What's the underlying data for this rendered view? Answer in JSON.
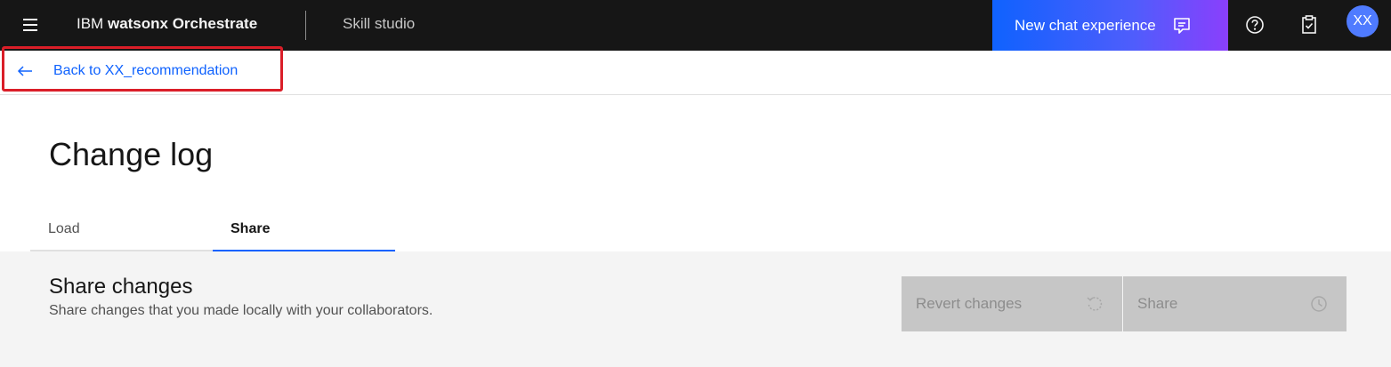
{
  "header": {
    "brand_prefix": "IBM",
    "brand_name": "watsonx Orchestrate",
    "section": "Skill studio",
    "new_chat_label": "New chat experience",
    "avatar_initials": "XX",
    "colors": {
      "bar": "#161616",
      "new_chat_start": "#0f62fe",
      "new_chat_end": "#8a3ffc",
      "avatar": "#4f7bff"
    },
    "icons": [
      "menu-icon",
      "chat-icon",
      "help-icon",
      "clipboard-check-icon"
    ]
  },
  "nav": {
    "back_label": "Back to XX_recommendation",
    "back_icon": "arrow-left-icon"
  },
  "page": {
    "title": "Change log"
  },
  "tabs": [
    {
      "label": "Load",
      "active": false
    },
    {
      "label": "Share",
      "active": true
    }
  ],
  "share_panel": {
    "title": "Share changes",
    "description": "Share changes that you made locally with your collaborators.",
    "revert_label": "Revert changes",
    "revert_icon": "reset-icon",
    "share_label": "Share",
    "share_icon": "clock-icon"
  },
  "accent_color": "#0f62fe",
  "highlight_color": "#da1e28"
}
